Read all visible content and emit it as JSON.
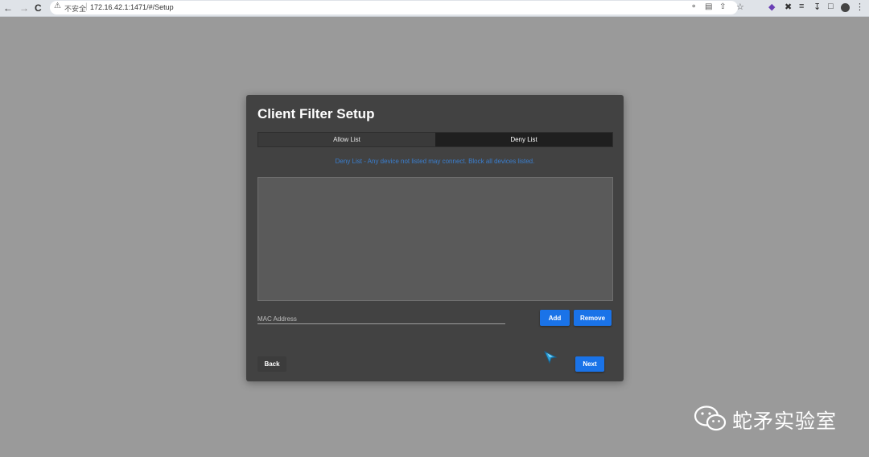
{
  "browser": {
    "security_label": "不安全",
    "url": "172.16.42.1:1471/#/Setup",
    "icons": [
      "back-arrow-icon",
      "forward-arrow-icon",
      "reload-icon",
      "warning-icon",
      "key-icon",
      "translate-icon",
      "share-icon",
      "bookmark-star-icon"
    ]
  },
  "dialog": {
    "title": "Client Filter Setup",
    "tabs": [
      {
        "label": "Allow List",
        "active": false
      },
      {
        "label": "Deny List",
        "active": true
      }
    ],
    "hint": "Deny List - Any device not listed may connect. Block all devices listed.",
    "mac_placeholder": "MAC Address",
    "add_label": "Add",
    "remove_label": "Remove",
    "back_label": "Back",
    "next_label": "Next"
  },
  "watermark": {
    "text": "蛇矛实验室"
  },
  "colors": {
    "page_bg": "#9a9a9a",
    "dialog_bg": "#424242",
    "accent": "#1a73e8",
    "hint": "#3a7fd0"
  }
}
